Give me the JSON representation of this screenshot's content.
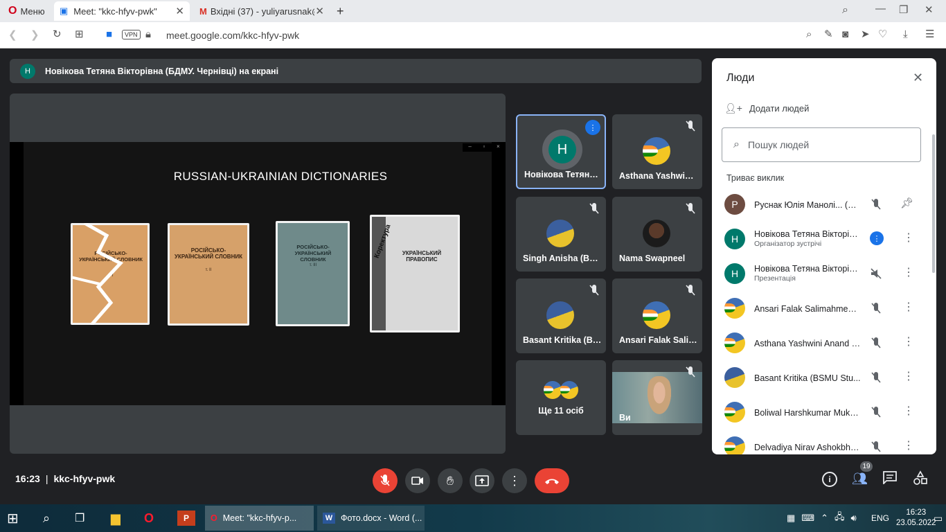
{
  "browser": {
    "menu_label": "Меню",
    "tabs": [
      {
        "title": "Meet: \"kkc-hfyv-pwk\"",
        "active": true
      },
      {
        "title": "Вхідні (37) - yuliyarusnak@",
        "active": false
      }
    ],
    "vpn_badge": "VPN",
    "url": "meet.google.com/kkc-hfyv-pwk"
  },
  "meet": {
    "presenting_banner": {
      "initial": "Н",
      "text": "Новікова Тетяна Вікторівна (БДМУ. Чернівці) на екрані"
    },
    "slide": {
      "title": "RUSSIAN-UKRAINIAN DICTIONARIES",
      "books": [
        {
          "title": "РОСІЙСЬКО-УКРАЇНСЬКИЙ СЛОВНИК",
          "sub": "т. І"
        },
        {
          "title": "РОСІЙСЬКО-УКРАЇНСЬКИЙ СЛОВНИК",
          "sub": "т. ІІ"
        },
        {
          "title": "РОСІЙСЬКО-УКРАЇНСЬКИЙ СЛОВНИК",
          "sub": "т. ІІІ"
        },
        {
          "title": "УКРАЇНСЬКИЙ ПРАВОПИС",
          "sub": "Коректура"
        }
      ]
    },
    "tiles": [
      {
        "name": "Новікова Тетяна Вікторівна",
        "initial": "Н",
        "speaking": true
      },
      {
        "name": "Asthana Yashwini Anand"
      },
      {
        "name": "Singh Anisha (BSMU Student)"
      },
      {
        "name": "Nama Swapneel"
      },
      {
        "name": "Basant Kritika (BSMU Student)"
      },
      {
        "name": "Ansari Falak Salimahmed"
      },
      {
        "name": "Ще 11 осіб"
      },
      {
        "name": "Ви"
      }
    ],
    "people_panel": {
      "title": "Люди",
      "add_people": "Додати людей",
      "search_placeholder": "Пошук людей",
      "section": "Триває виклик",
      "people": [
        {
          "name": "Руснак Юлія Манолі... (Ви)",
          "initial": "Р",
          "avatar_color": "#6d4c41"
        },
        {
          "name": "Новікова Тетяна Вікторів...",
          "sub": "Організатор зустрічі",
          "initial": "Н",
          "avatar_color": "#00796b"
        },
        {
          "name": "Новікова Тетяна Вікторів...",
          "sub": "Презентація",
          "initial": "Н",
          "avatar_color": "#00796b"
        },
        {
          "name": "Ansari Falak Salimahmed ..."
        },
        {
          "name": "Asthana Yashwini Anand (..."
        },
        {
          "name": "Basant Kritika (BSMU Stu..."
        },
        {
          "name": "Boliwal Harshkumar Muke..."
        },
        {
          "name": "Delvadiya Nirav Ashokbha..."
        }
      ]
    },
    "bottom": {
      "time": "16:23",
      "separator": "|",
      "meeting_code": "kkc-hfyv-pwk",
      "participants_count": "19"
    }
  },
  "taskbar": {
    "apps": [
      {
        "label": "Meet: \"kkc-hfyv-p..."
      },
      {
        "label": "Фото.docx - Word (..."
      }
    ],
    "lang": "ENG",
    "time": "16:23",
    "date": "23.05.2022"
  },
  "colors": {
    "accent_blue": "#8ab4f8",
    "end_call_red": "#ea4335",
    "speaking_blue": "#1a73e8"
  }
}
